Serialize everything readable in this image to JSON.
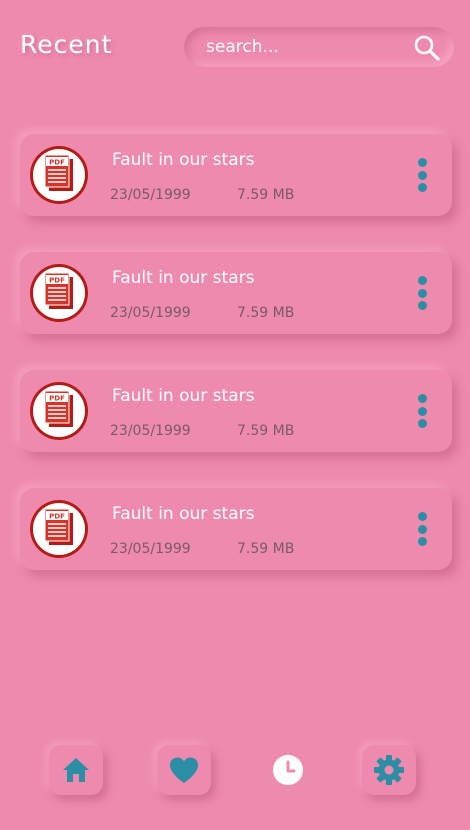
{
  "header": {
    "title": "Recent"
  },
  "search": {
    "placeholder": "search..."
  },
  "files": [
    {
      "name": "Fault in our stars",
      "date": "23/05/1999",
      "size": "7.59 MB",
      "icon": "pdf-file-icon"
    },
    {
      "name": "Fault in our stars",
      "date": "23/05/1999",
      "size": "7.59 MB",
      "icon": "pdf-file-icon"
    },
    {
      "name": "Fault in our stars",
      "date": "23/05/1999",
      "size": "7.59 MB",
      "icon": "pdf-file-icon"
    },
    {
      "name": "Fault in our stars",
      "date": "23/05/1999",
      "size": "7.59 MB",
      "icon": "pdf-file-icon"
    }
  ],
  "pdf_badge_text": "PDF",
  "nav": {
    "items": [
      {
        "icon": "home-icon",
        "active": false
      },
      {
        "icon": "heart-icon",
        "active": false
      },
      {
        "icon": "clock-icon",
        "active": true
      },
      {
        "icon": "gear-icon",
        "active": false
      }
    ]
  },
  "colors": {
    "background": "#ee8aae",
    "accent": "#2c8ea4",
    "text_primary": "#ffffff",
    "text_secondary": "#7a5a66",
    "pdf_red": "#c8261c"
  }
}
